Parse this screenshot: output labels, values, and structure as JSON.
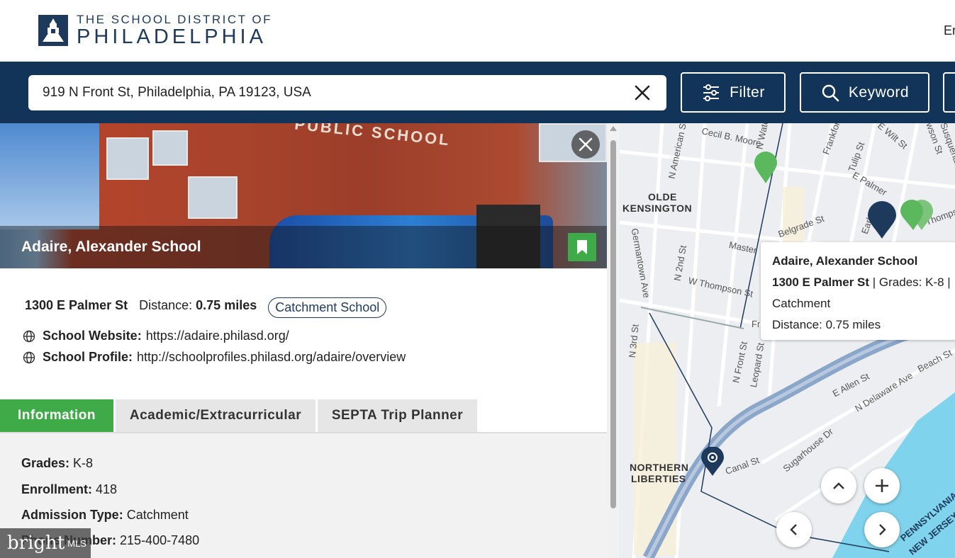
{
  "header": {
    "logo_line1": "THE SCHOOL DISTRICT OF",
    "logo_line2": "PHILADELPHIA",
    "language": "En"
  },
  "search": {
    "value": "919 N Front St, Philadelphia, PA 19123, USA",
    "filter_label": "Filter",
    "keyword_label": "Keyword"
  },
  "school": {
    "name": "Adaire, Alexander School",
    "photo_lettering": "PUBLIC SCHOOL",
    "address": "1300 E Palmer St",
    "distance_label": "Distance:",
    "distance_value": "0.75 miles",
    "badge": "Catchment School",
    "website_label": "School Website:",
    "website_url": "https://adaire.philasd.org/",
    "profile_label": "School Profile:",
    "profile_url": "http://schoolprofiles.philasd.org/adaire/overview"
  },
  "tabs": [
    {
      "label": "Information",
      "active": true
    },
    {
      "label": "Academic/Extracurricular",
      "active": false
    },
    {
      "label": "SEPTA Trip Planner",
      "active": false
    }
  ],
  "info": {
    "grades_label": "Grades:",
    "grades_value": "K-8",
    "enrollment_label": "Enrollment:",
    "enrollment_value": "418",
    "admission_label": "Admission Type:",
    "admission_value": "Catchment",
    "phone_label": "Phone Number:",
    "phone_value": "215-400-7480"
  },
  "map": {
    "neighborhoods": [
      "OLDE",
      "KENSINGTON",
      "NORTHERN",
      "LIBERTIES"
    ],
    "streets": [
      "Cecil B. Moore",
      "N American St",
      "N Water",
      "N Front St",
      "Frankford",
      "Tulip St",
      "E Palmer",
      "E Wilt St",
      "Hewson St",
      "Susquehanna",
      "Belgrade St",
      "Earl St",
      "Thompson",
      "Master",
      "N 2nd St",
      "W Thompson St",
      "Germantown Ave",
      "N 3rd St",
      "Leopard St",
      "Fr",
      "E Allen St",
      "N Delaware Ave",
      "Beach St",
      "Sugarhouse Dr",
      "Canal St",
      "PENNSYLVANIA",
      "NEW JERSEY"
    ],
    "popup": {
      "name": "Adaire, Alexander School",
      "address": "1300 E Palmer St",
      "grades": "| Grades: K-8 |",
      "type": "Catchment",
      "distance": "Distance: 0.75 miles"
    },
    "colors": {
      "water": "#7fd3ec",
      "highway": "#8aa6c9",
      "green_marker": "#5cb85c",
      "selected_marker": "#1d3a5c"
    }
  },
  "watermark": {
    "brand": "bright",
    "suffix": "MLS"
  },
  "colors": {
    "navy": "#123459",
    "green": "#3faa48"
  }
}
